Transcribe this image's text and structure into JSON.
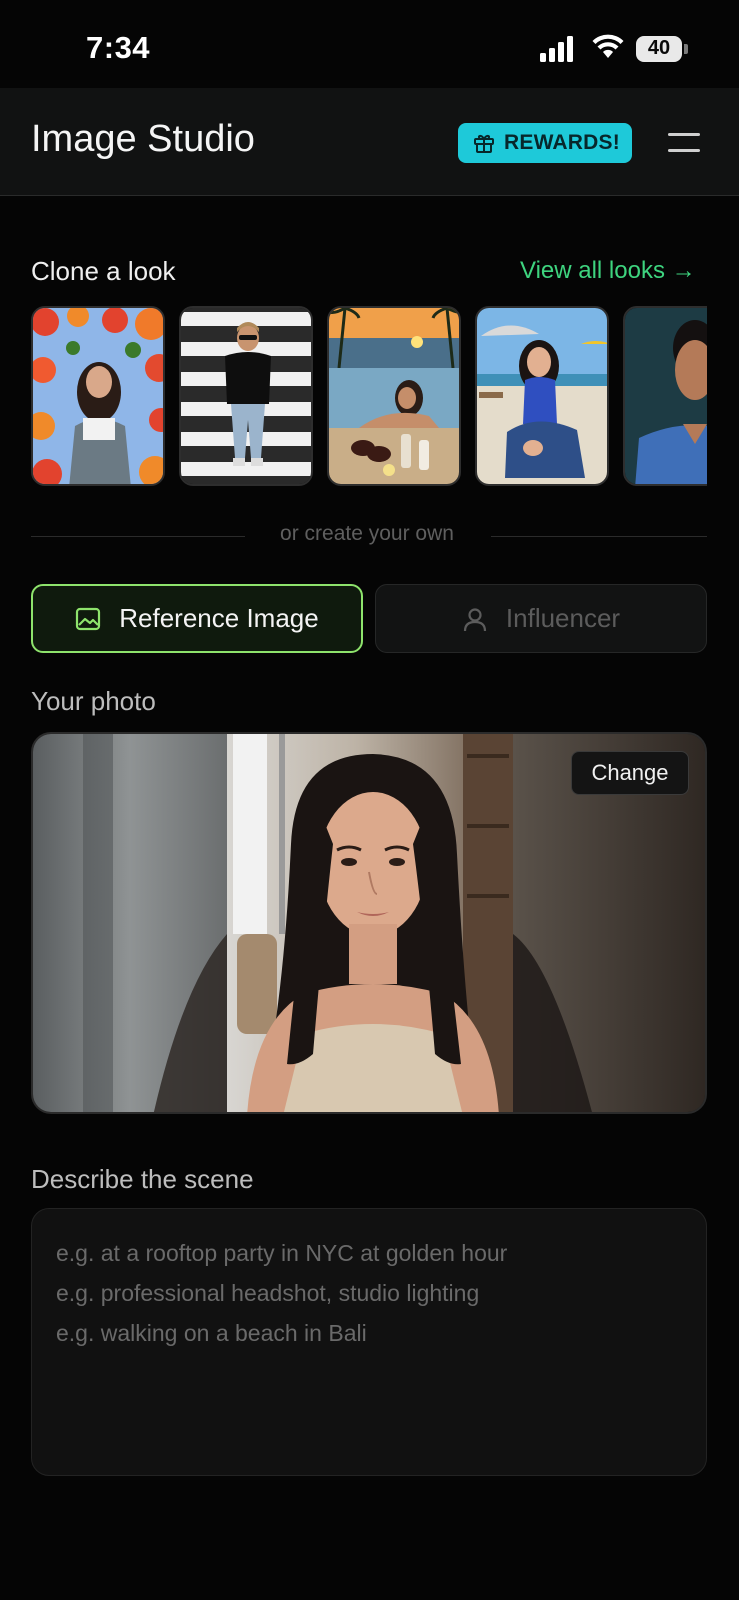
{
  "status_bar": {
    "time": "7:34",
    "battery": "40"
  },
  "header": {
    "title": "Image Studio",
    "rewards_label": "REWARDS!"
  },
  "clone": {
    "title": "Clone a look",
    "view_all": "View all looks →",
    "looks": [
      {
        "name": "flower-portrait"
      },
      {
        "name": "crosswalk-man"
      },
      {
        "name": "beach-collage"
      },
      {
        "name": "beach-sitting"
      },
      {
        "name": "blue-shirt-portrait"
      }
    ]
  },
  "divider_text": "or create your own",
  "modes": {
    "reference": "Reference Image",
    "influencer": "Influencer",
    "active": "reference"
  },
  "photo": {
    "label": "Your photo",
    "change": "Change"
  },
  "describe": {
    "label": "Describe the scene",
    "placeholder": "e.g. at a rooftop party in NYC at golden hour\ne.g. professional headshot, studio lighting\ne.g. walking on a beach in Bali"
  },
  "colors": {
    "accent_green": "#8ee36c",
    "link_green": "#3ed47f",
    "rewards_cyan": "#1ec9d9",
    "background": "#050505"
  }
}
